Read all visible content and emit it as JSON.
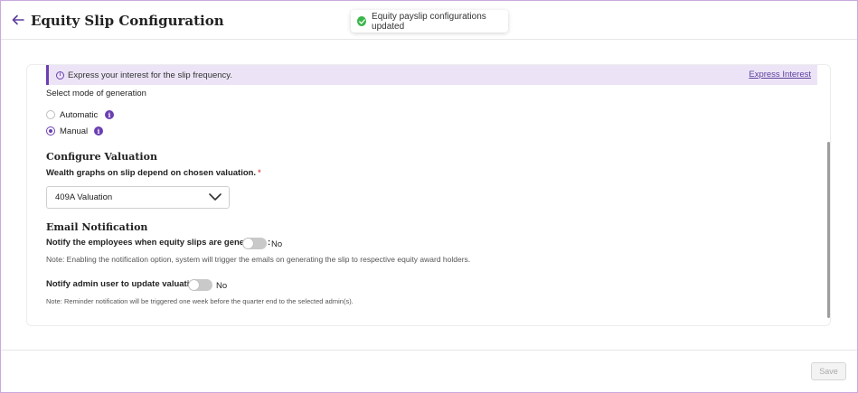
{
  "header": {
    "title": "Equity Slip Configuration",
    "back_icon": "arrow-left-icon"
  },
  "toast": {
    "message": "Equity payslip configurations updated",
    "icon": "check-circle-icon",
    "color": "#3bb54a"
  },
  "banner": {
    "message": "Express your interest for the slip frequency.",
    "link": "Express Interest",
    "accent": "#6b3fb2"
  },
  "generation": {
    "label": "Select mode of generation",
    "options": [
      {
        "label": "Automatic",
        "selected": false
      },
      {
        "label": "Manual",
        "selected": true
      }
    ],
    "info_glyph": "i"
  },
  "valuation": {
    "title": "Configure Valuation",
    "label": "Wealth graphs on slip depend on chosen valuation.",
    "required_mark": "*",
    "selected": "409A Valuation"
  },
  "email": {
    "title": "Email Notification",
    "employees_label": "Notify the employees when equity slips are generated :",
    "employees_toggle": "No",
    "employees_note": "Note: Enabling the notification option, system will trigger the emails on generating the slip to respective equity award holders.",
    "admin_label": "Notify admin user to update valuation :",
    "admin_toggle": "No",
    "admin_note": "Note: Reminder notification will be triggered one week before the quarter end to the selected admin(s)."
  },
  "footer": {
    "save_label": "Save"
  }
}
